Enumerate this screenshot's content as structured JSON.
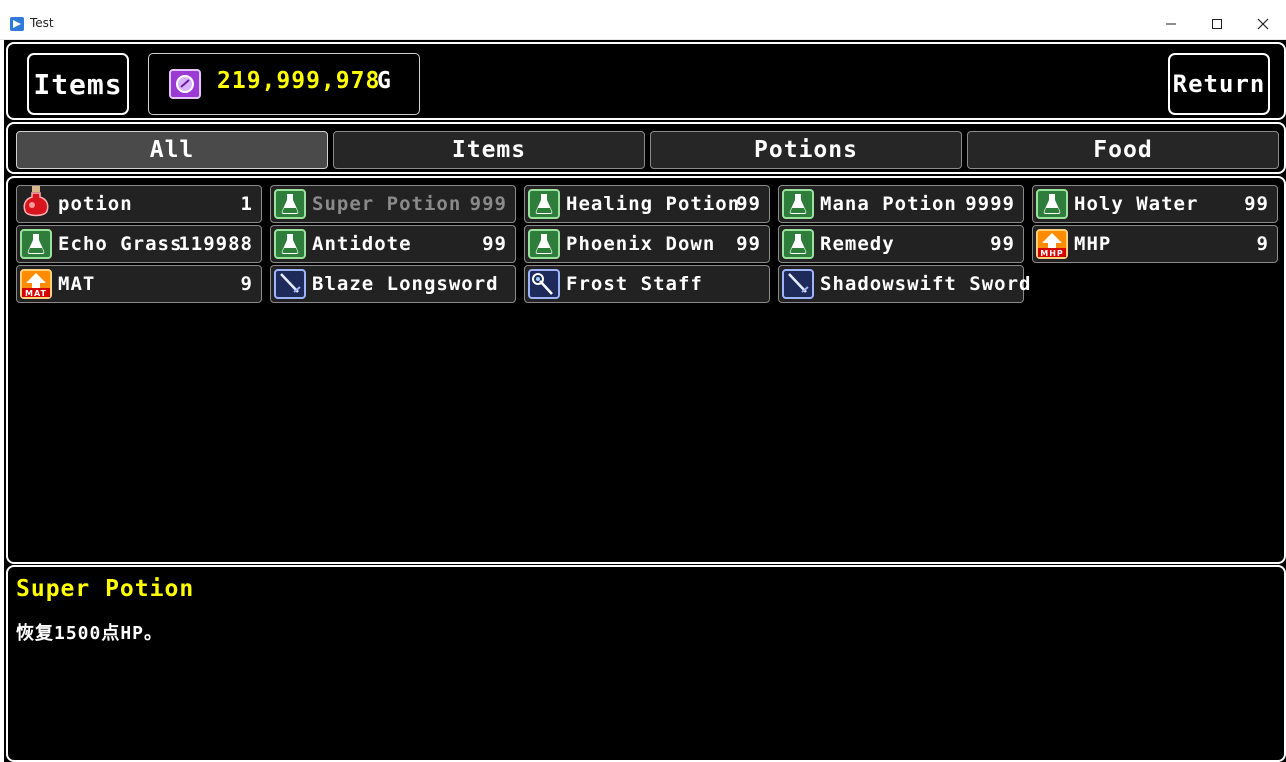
{
  "window": {
    "title": "Test",
    "icon": "app-icon",
    "min_symbol": "—",
    "max_symbol": "☐",
    "close_symbol": "✕"
  },
  "header": {
    "title": "Items",
    "gold_value": "219,999,978",
    "gold_unit": "G",
    "gold_icon": "coin-icon",
    "return_label": "Return"
  },
  "tabs": [
    {
      "label": "All",
      "selected": true
    },
    {
      "label": "Items",
      "selected": false
    },
    {
      "label": "Potions",
      "selected": false
    },
    {
      "label": "Food",
      "selected": false
    }
  ],
  "items": [
    {
      "name": "potion",
      "qty": "1",
      "icon": "red-potion-icon"
    },
    {
      "name": "Super Potion",
      "qty": "999",
      "icon": "potion-flask-icon",
      "disabled": true
    },
    {
      "name": "Healing Potion",
      "qty": "99",
      "icon": "potion-flask-icon"
    },
    {
      "name": "Mana Potion",
      "qty": "9999",
      "icon": "potion-flask-icon"
    },
    {
      "name": "Holy Water",
      "qty": "99",
      "icon": "potion-flask-icon"
    },
    {
      "name": "Echo Grass",
      "qty": "119988",
      "icon": "potion-flask-icon"
    },
    {
      "name": "Antidote",
      "qty": "99",
      "icon": "potion-flask-icon"
    },
    {
      "name": "Phoenix Down",
      "qty": "99",
      "icon": "potion-flask-icon"
    },
    {
      "name": "Remedy",
      "qty": "99",
      "icon": "potion-flask-icon"
    },
    {
      "name": "MHP",
      "qty": "9",
      "icon": "mhp-up-icon"
    },
    {
      "name": "MAT",
      "qty": "9",
      "icon": "mat-up-icon"
    },
    {
      "name": "Blaze Longsword",
      "qty": "",
      "icon": "sword-icon"
    },
    {
      "name": "Frost Staff",
      "qty": "",
      "icon": "staff-icon"
    },
    {
      "name": "Shadowswift Sword",
      "qty": "",
      "icon": "sword-icon"
    }
  ],
  "help": {
    "name": "Super Potion",
    "description": "恢复1500点HP。"
  },
  "colors": {
    "highlight": "#ffff00",
    "panel_bg": "#000000",
    "slot_bg": "#222222",
    "disabled_text": "#8a8a8a"
  }
}
